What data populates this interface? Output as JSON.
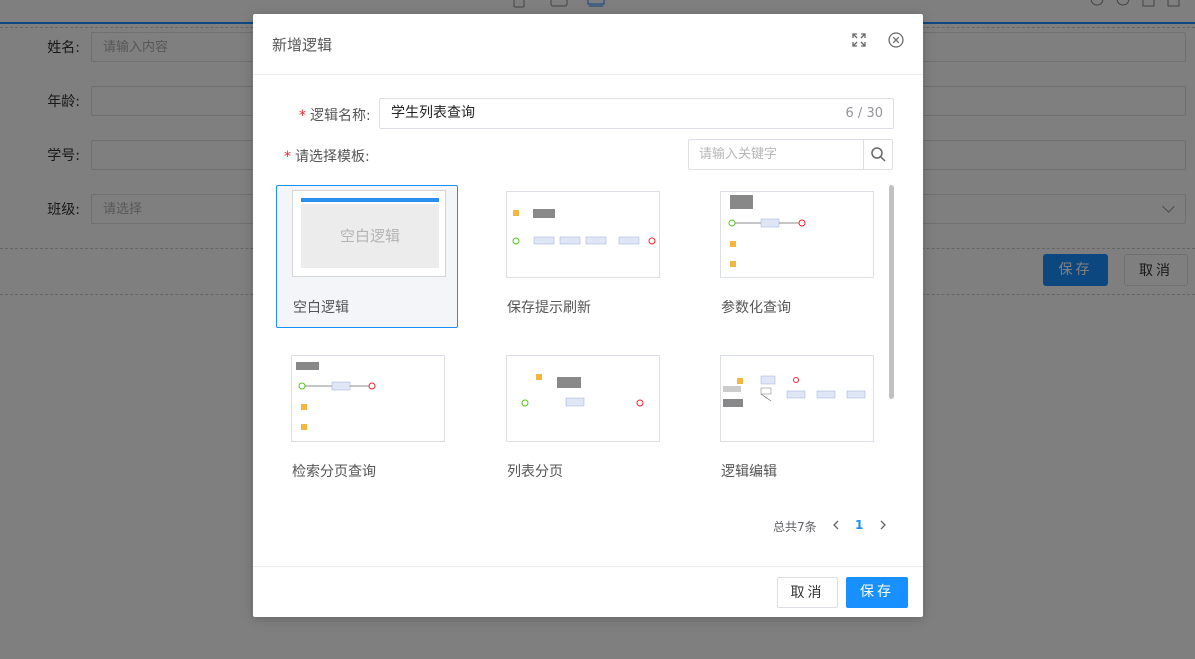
{
  "background_form": {
    "fields": [
      {
        "label": "姓名:",
        "placeholder": "请输入内容"
      },
      {
        "label": "年龄:",
        "placeholder": ""
      },
      {
        "label": "学号:",
        "placeholder": ""
      },
      {
        "label": "班级:",
        "placeholder": "请选择"
      }
    ],
    "save_label": "保存",
    "cancel_label": "取消"
  },
  "dialog": {
    "title": "新增逻辑",
    "header_icons": [
      "expand-icon",
      "close-icon"
    ],
    "name_field": {
      "required_mark": "*",
      "label": "逻辑名称:",
      "value": "学生列表查询",
      "count": "6 / 30"
    },
    "template_field": {
      "required_mark": "*",
      "label": "请选择模板:",
      "search_placeholder": "请输入关键字"
    },
    "templates": [
      {
        "label": "空白逻辑",
        "thumb_text": "空白逻辑",
        "selected": true
      },
      {
        "label": "保存提示刷新",
        "selected": false
      },
      {
        "label": "参数化查询",
        "selected": false
      },
      {
        "label": "检索分页查询",
        "selected": false
      },
      {
        "label": "列表分页",
        "selected": false
      },
      {
        "label": "逻辑编辑",
        "selected": false
      }
    ],
    "pagination": {
      "total_text": "总共7条",
      "current_page": "1"
    },
    "footer": {
      "cancel_label": "取消",
      "save_label": "保存"
    }
  },
  "colors": {
    "primary": "#1890ff",
    "required": "#f5222d",
    "mask": "rgba(0,0,0,0.5)"
  }
}
